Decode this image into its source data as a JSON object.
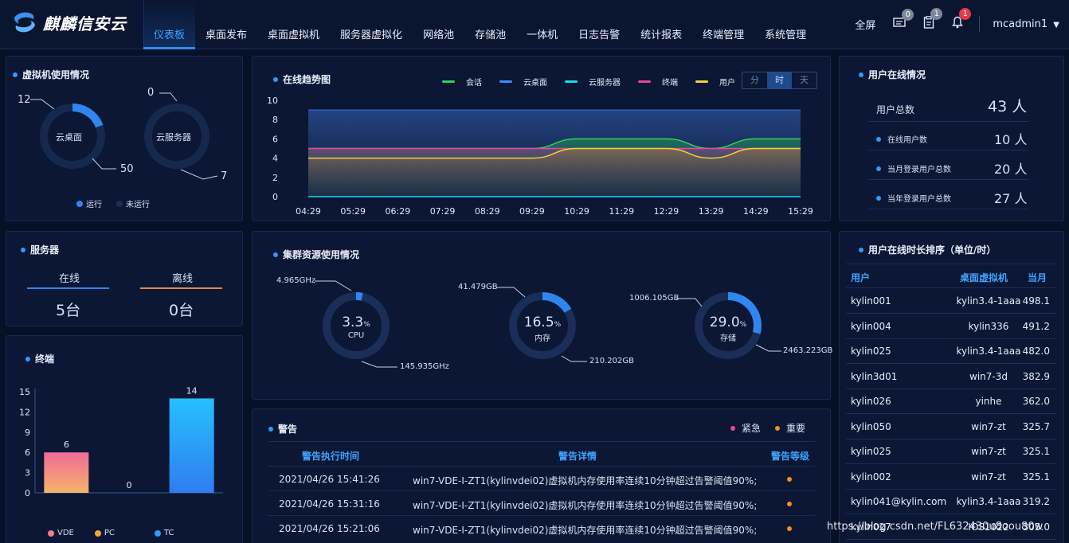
{
  "app": {
    "name": "麒麟信安云"
  },
  "nav": [
    "仪表板",
    "桌面发布",
    "桌面虚拟机",
    "服务器虚拟化",
    "网络池",
    "存储池",
    "一体机",
    "日志告警",
    "统计报表",
    "终端管理",
    "系统管理"
  ],
  "header": {
    "fullscreen": "全屏",
    "msg_count": "0",
    "task_count": "1",
    "bell_count": "1",
    "user": "mcadmin1"
  },
  "vm_usage": {
    "title": "虚拟机使用情况",
    "desktop": {
      "label": "云桌面",
      "running": 12,
      "stopped": 50
    },
    "server": {
      "label": "云服务器",
      "running": 0,
      "stopped": 7
    },
    "legend_running": "运行",
    "legend_stopped": "未运行"
  },
  "servers": {
    "title": "服务器",
    "online_label": "在线",
    "offline_label": "离线",
    "online_value": "5台",
    "offline_value": "0台"
  },
  "terminals": {
    "title": "终端",
    "legend": [
      "VDE",
      "PC",
      "TC"
    ]
  },
  "trend": {
    "title": "在线趋势图",
    "legend": [
      "会话",
      "云桌面",
      "云服务器",
      "终端",
      "用户"
    ],
    "range_buttons": [
      "分",
      "时",
      "天"
    ],
    "active_range": "时"
  },
  "cluster": {
    "title": "集群资源使用情况",
    "cpu": {
      "label": "CPU",
      "percent": 3.3,
      "pct_text": "3.3",
      "used": "4.965GHz",
      "total": "145.935GHz"
    },
    "memory": {
      "label": "内存",
      "percent": 16.5,
      "pct_text": "16.5",
      "used": "41.479GB",
      "total": "210.202GB"
    },
    "storage": {
      "label": "存储",
      "percent": 29.0,
      "pct_text": "29.0",
      "used": "1006.105GB",
      "total": "2463.223GB"
    },
    "pct_sign": "%"
  },
  "alarms": {
    "title": "警告",
    "legend_urgent": "紧急",
    "legend_important": "重要",
    "headers": [
      "警告执行时间",
      "警告详情",
      "警告等级"
    ],
    "rows": [
      {
        "time": "2021/04/26 15:41:26",
        "detail": "win7-VDE-I-ZT1(kylinvdei02)虚拟机内存使用率连续10分钟超过告警阈值90%;"
      },
      {
        "time": "2021/04/26 15:31:16",
        "detail": "win7-VDE-I-ZT1(kylinvdei02)虚拟机内存使用率连续10分钟超过告警阈值90%;"
      },
      {
        "time": "2021/04/26 15:21:06",
        "detail": "win7-VDE-I-ZT1(kylinvdei02)虚拟机内存使用率连续10分钟超过告警阈值90%;"
      }
    ]
  },
  "user_online": {
    "title": "用户在线情况",
    "total_label": "用户总数",
    "total_value": "43 人",
    "items": [
      {
        "label": "在线用户数",
        "value": "10 人"
      },
      {
        "label": "当月登录用户总数",
        "value": "20 人"
      },
      {
        "label": "当年登录用户总数",
        "value": "27 人"
      }
    ]
  },
  "duration_rank": {
    "title": "用户在线时长排序（单位/时）",
    "headers": [
      "用户",
      "桌面虚拟机",
      "当月"
    ],
    "rows": [
      {
        "user": "kylin001",
        "vm": "kylin3.4-1aaa",
        "hours": "498.1"
      },
      {
        "user": "kylin004",
        "vm": "kylin336",
        "hours": "491.2"
      },
      {
        "user": "kylin025",
        "vm": "kylin3.4-1aaa",
        "hours": "482.0"
      },
      {
        "user": "kylin3d01",
        "vm": "win7-3d",
        "hours": "382.9"
      },
      {
        "user": "kylin026",
        "vm": "yinhe",
        "hours": "362.0"
      },
      {
        "user": "kylin050",
        "vm": "win7-zt",
        "hours": "325.7"
      },
      {
        "user": "kylin025",
        "vm": "win7-zt",
        "hours": "325.1"
      },
      {
        "user": "kylin002",
        "vm": "win7-zt",
        "hours": "325.1"
      },
      {
        "user": "kylin041@kylin.com",
        "vm": "kylin3.4-1aaa",
        "hours": "319.2"
      },
      {
        "user": "kylin027",
        "vm": "IOS1022",
        "hours": "305.0"
      }
    ]
  },
  "watermark": "https://blog.csdn.net/FL632430u8oou80w",
  "chart_data": [
    {
      "type": "line",
      "title": "在线趋势图",
      "x": [
        "04:29",
        "05:29",
        "06:29",
        "07:29",
        "08:29",
        "09:29",
        "10:29",
        "11:29",
        "12:29",
        "13:29",
        "14:29",
        "15:29"
      ],
      "ylim": [
        0,
        10
      ],
      "yticks": [
        0,
        2,
        4,
        6,
        8,
        10
      ],
      "series": [
        {
          "name": "会话",
          "color": "#2fd35a",
          "values": [
            5,
            5,
            5,
            5,
            5,
            5,
            6,
            6,
            6,
            5,
            6,
            6
          ]
        },
        {
          "name": "云桌面",
          "color": "#3b8cff",
          "values": [
            9,
            9,
            9,
            9,
            9,
            9,
            9,
            9,
            9,
            9,
            9,
            9
          ]
        },
        {
          "name": "云服务器",
          "color": "#19d9f0",
          "values": [
            0,
            0,
            0,
            0,
            0,
            0,
            0,
            0,
            0,
            0,
            0,
            0
          ]
        },
        {
          "name": "终端",
          "color": "#e8479a",
          "values": [
            5,
            5,
            5,
            5,
            5,
            5,
            5,
            5,
            5,
            5,
            5,
            5
          ]
        },
        {
          "name": "用户",
          "color": "#f2d23c",
          "values": [
            4,
            4,
            4,
            4,
            4,
            4,
            5,
            5,
            5,
            4,
            5,
            5
          ]
        }
      ]
    },
    {
      "type": "bar",
      "title": "终端",
      "categories": [
        "VDE",
        "PC",
        "TC"
      ],
      "values": [
        6,
        0,
        14
      ],
      "colors": [
        "#f37c8a",
        "#f4a63a",
        "#2f9bff"
      ],
      "ylim": [
        0,
        15
      ],
      "yticks": [
        0,
        3,
        6,
        9,
        12,
        15
      ]
    }
  ]
}
